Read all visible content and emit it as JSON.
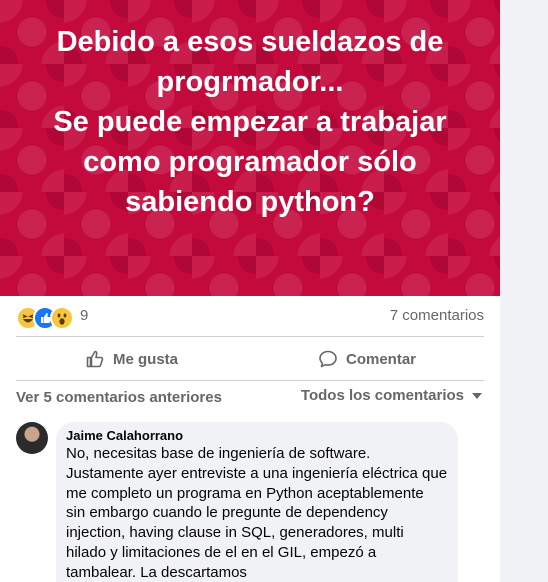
{
  "banner": {
    "lines": [
      "Debido a esos sueldazos de",
      "progrmador...",
      "Se puede empezar a trabajar",
      "como programador sólo",
      "sabiendo python?"
    ],
    "color": "#c40a3d"
  },
  "reactions": {
    "icons": [
      "haha-icon",
      "like-icon",
      "wow-icon"
    ],
    "count": "9",
    "comments_count": "7 comentarios"
  },
  "actions": {
    "like_label": "Me gusta",
    "comment_label": "Comentar"
  },
  "comments_bar": {
    "previous_label": "Ver 5 comentarios anteriores",
    "filter_label": "Todos los comentarios"
  },
  "comment": {
    "author": "Jaime Calahorrano",
    "lines": [
      "No, necesitas base de ingeniería de software.",
      "Justamente ayer entreviste a una ingeniería eléctrica que",
      "me completo un programa en Python aceptablemente",
      "sin embargo cuando le pregunte de dependency",
      "injection, having clause in SQL, generadores, multi",
      "hilado y limitaciones de el en el GIL, empezó a",
      "tambalear. La descartamos"
    ]
  }
}
